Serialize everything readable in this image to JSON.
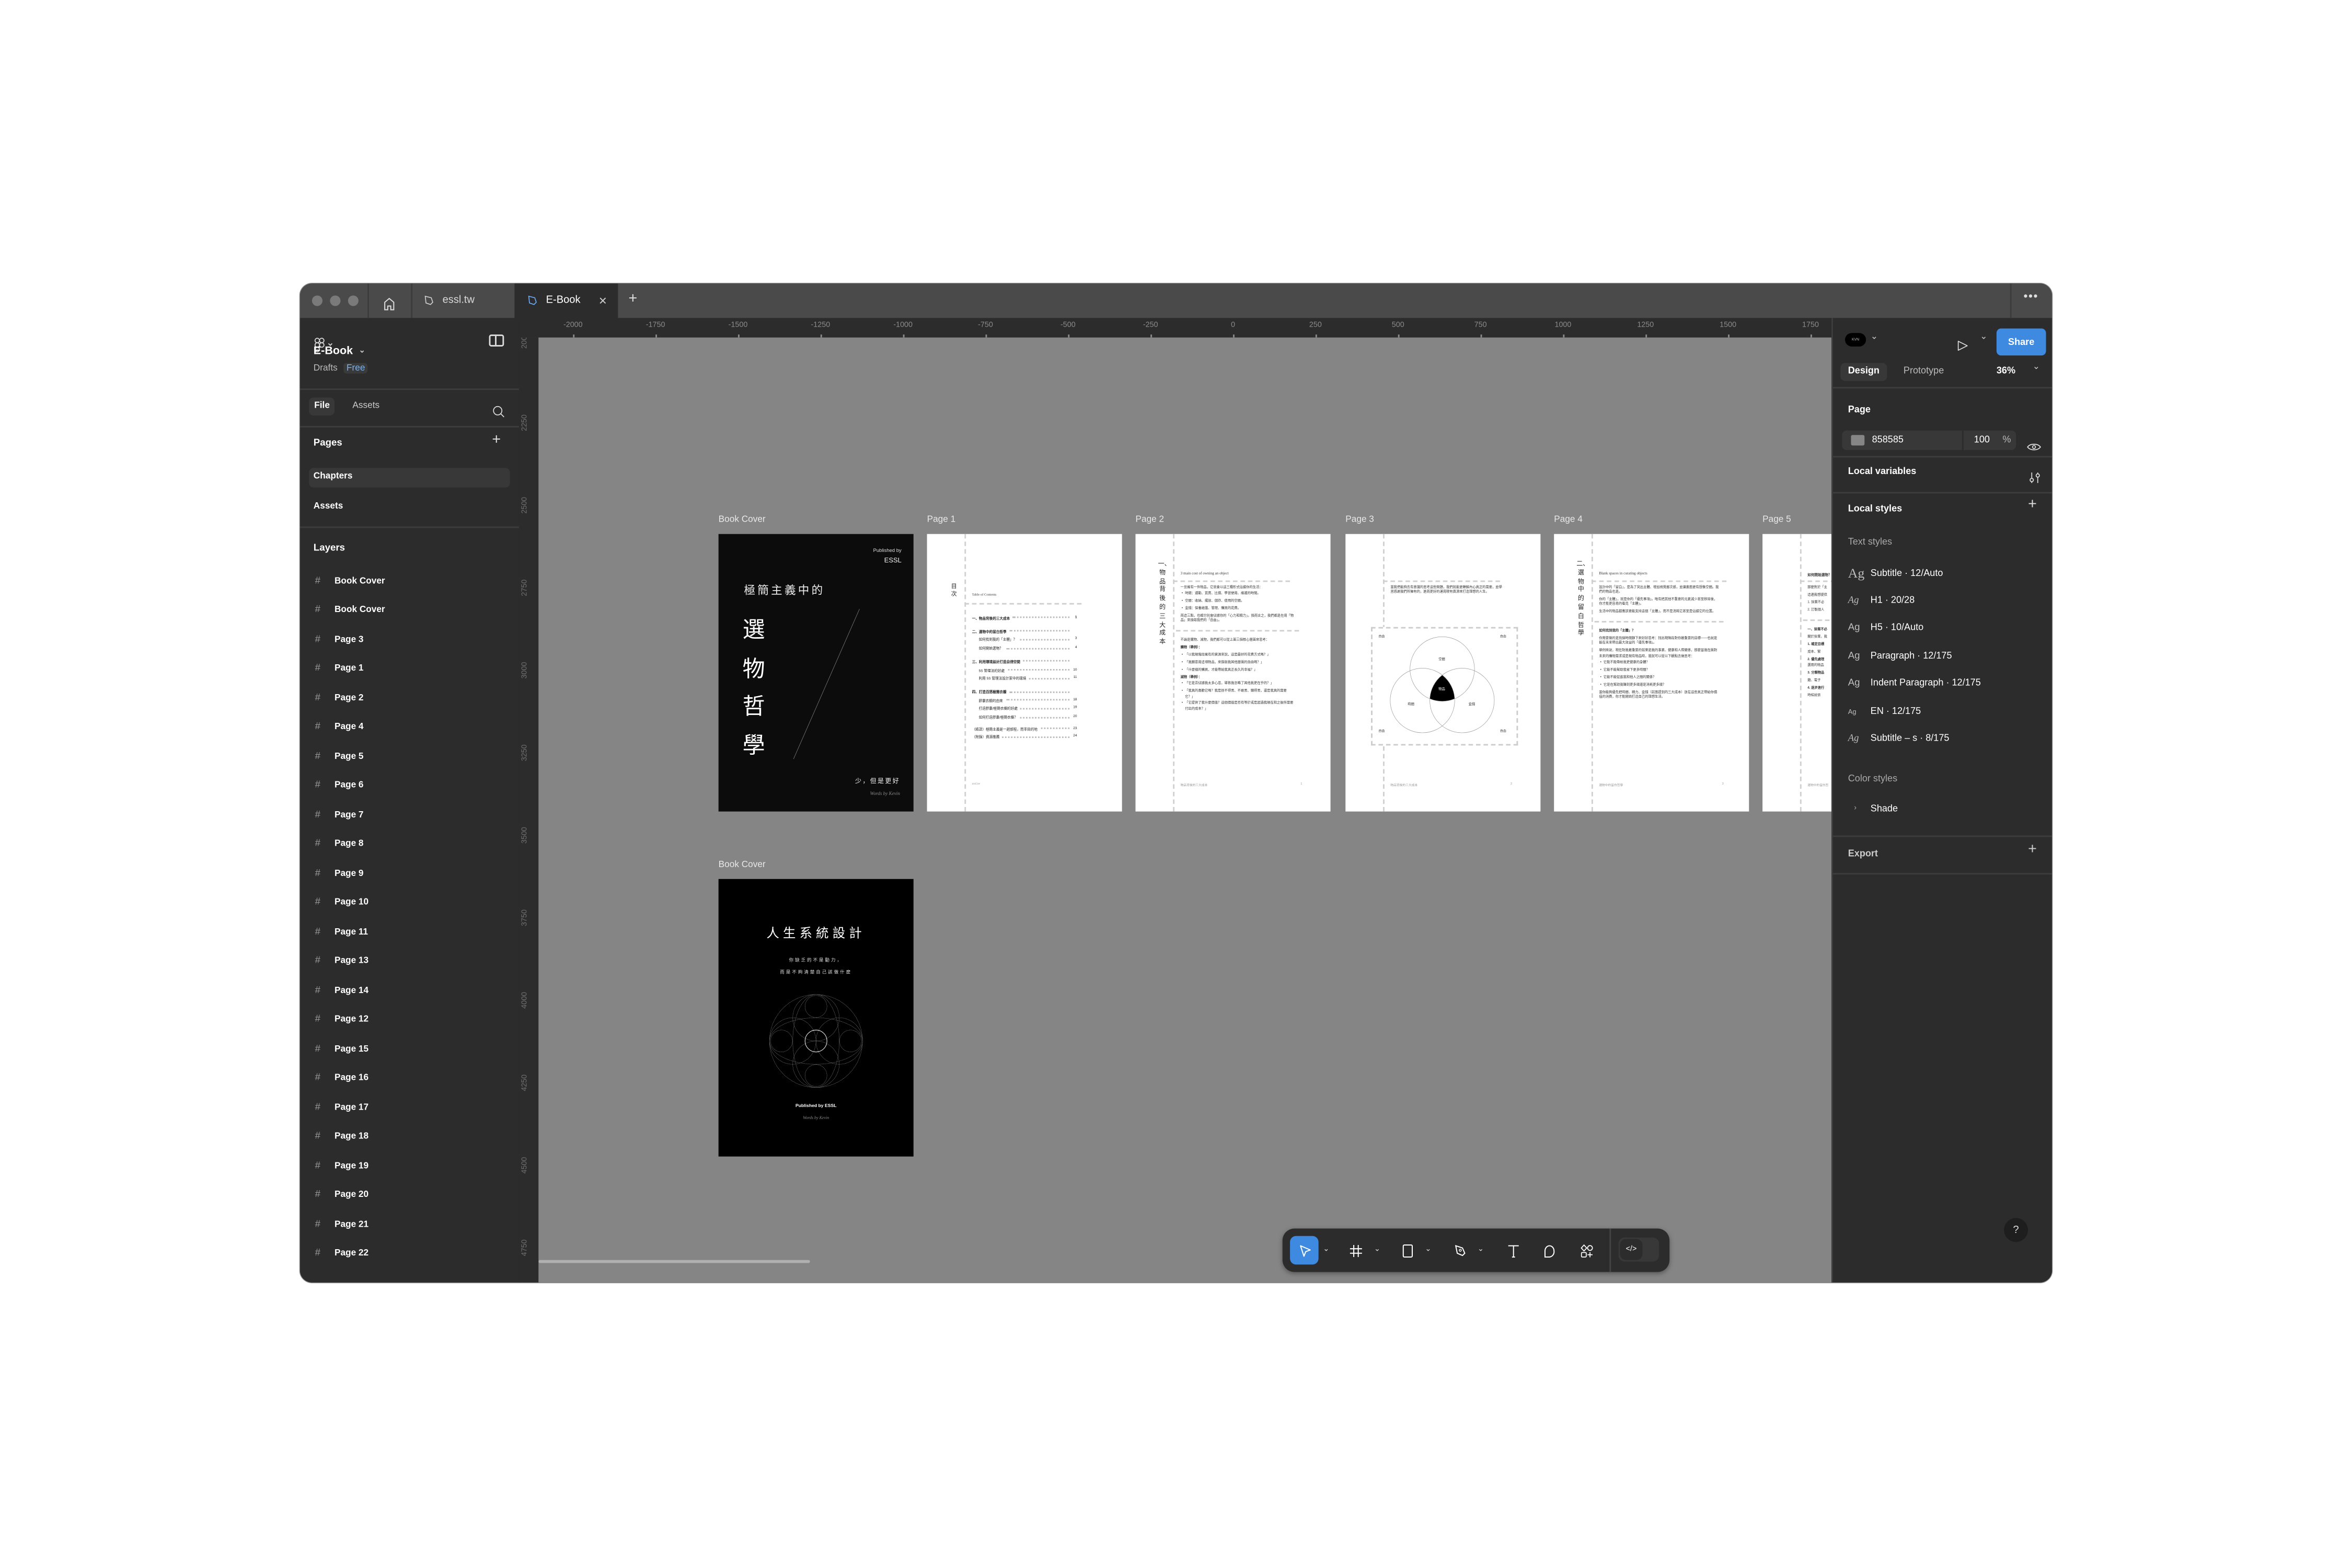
{
  "tabs": {
    "home_icon": "home-icon",
    "items": [
      {
        "label": "essl.tw",
        "active": false
      },
      {
        "label": "E-Book",
        "active": true
      }
    ],
    "new_tab_icon": "plus-icon",
    "more_icon": "ellipsis-icon"
  },
  "sidebar": {
    "file_name": "E-Book",
    "location": "Drafts",
    "plan_badge": "Free",
    "tab_file": "File",
    "tab_assets": "Assets",
    "pages_heading": "Pages",
    "pages": [
      {
        "label": "Chapters",
        "selected": true
      },
      {
        "label": "Assets",
        "selected": false
      }
    ],
    "layers_heading": "Layers",
    "layers": [
      {
        "label": "Book Cover"
      },
      {
        "label": "Book Cover"
      },
      {
        "label": "Page 3"
      },
      {
        "label": "Page 1"
      },
      {
        "label": "Page 2"
      },
      {
        "label": "Page 4"
      },
      {
        "label": "Page 5"
      },
      {
        "label": "Page 6"
      },
      {
        "label": "Page 7"
      },
      {
        "label": "Page 8"
      },
      {
        "label": "Page 9"
      },
      {
        "label": "Page 10"
      },
      {
        "label": "Page 11"
      },
      {
        "label": "Page 13"
      },
      {
        "label": "Page 14"
      },
      {
        "label": "Page 12"
      },
      {
        "label": "Page 15"
      },
      {
        "label": "Page 16"
      },
      {
        "label": "Page 17"
      },
      {
        "label": "Page 18"
      },
      {
        "label": "Page 19"
      },
      {
        "label": "Page 20"
      },
      {
        "label": "Page 21"
      },
      {
        "label": "Page 22"
      }
    ]
  },
  "rulers": {
    "x_labels": [
      -2000,
      -1750,
      -1500,
      -1250,
      -1000,
      -750,
      -500,
      -250,
      0,
      250,
      500,
      750,
      1000,
      1250,
      1500,
      1750
    ],
    "y_labels": [
      2000,
      2250,
      2500,
      2750,
      3000,
      3250,
      3500,
      3750,
      4000,
      4250,
      4500,
      4750
    ]
  },
  "canvas": {
    "background": "#858585",
    "frames": {
      "cover1": {
        "label": "Book Cover",
        "published_by": "Published by",
        "publisher": "ESSL",
        "pre_title": "極簡主義中的",
        "title_chars": [
          "選",
          "物",
          "哲",
          "學"
        ],
        "tagline": "少，但是更好",
        "author": "Words by Kevin"
      },
      "page1": {
        "label": "Page 1",
        "side_title": "目次",
        "subtitle": "Table of Contents",
        "toc": [
          {
            "type": "h",
            "text": "一、物品背後的三大成本",
            "page": "1"
          },
          {
            "type": "h",
            "text": "二、選物中的留白哲學",
            "page": ""
          },
          {
            "type": "s",
            "text": "如何找到我的「主體」？",
            "page": "3"
          },
          {
            "type": "s",
            "text": "如何開始選物？",
            "page": "4"
          },
          {
            "type": "h",
            "text": "三、利用環境設計打造自律空間",
            "page": ""
          },
          {
            "type": "s",
            "text": "5S 管理法的好處",
            "page": "10"
          },
          {
            "type": "s",
            "text": "利用 5S 管理法設計家中的環境",
            "page": "11"
          },
          {
            "type": "h",
            "text": "四、打造百搭極簡衣櫥",
            "page": ""
          },
          {
            "type": "s",
            "text": "膠囊衣櫥的由來",
            "page": "18"
          },
          {
            "type": "s",
            "text": "打造膠囊/極簡衣櫥的好處",
            "page": "19"
          },
          {
            "type": "s",
            "text": "如何打造膠囊/極簡衣櫥？",
            "page": "20"
          },
          {
            "type": "e",
            "text": "（結語）極簡主義是一趟旅程，而非目的地",
            "page": "23"
          },
          {
            "type": "f",
            "text": "（附錄）資源推薦",
            "page": "24"
          }
        ],
        "footer": "essl.tw"
      },
      "page2": {
        "label": "Page 2",
        "side_title": "一、物品背後的三大成本",
        "subtitle": "3 main cost of owning an object",
        "blocks": [
          {
            "type": "p",
            "text": "一旦擁有一件物品，它就會以這三種形式佔據你的生活："
          },
          {
            "type": "bullet",
            "text": "時間：通勤、買賣、比價、學習使用、維護的時間。"
          },
          {
            "type": "bullet",
            "text": "空間：收納、擺放、儲存、使用的空間。"
          },
          {
            "type": "bullet",
            "text": "金錢：保養維護、管理、購買的花費。"
          },
          {
            "type": "p",
            "text": "而這三點，也都分別會佔據你的「心力和精力」。換而言之，我們都是在用「物品」來換取我們的「自由」。"
          },
          {
            "type": "divider-line",
            "text": ""
          },
          {
            "type": "p",
            "text": "不論是購物、減物，我們都可以從上面三個核心層面來思考："
          },
          {
            "type": "h",
            "text": "購物（舉例）："
          },
          {
            "type": "bullet",
            "text": "「以我現階段擁有的資源來說，這是最好的花費方式嗎？」"
          },
          {
            "type": "bullet",
            "text": "「我願意用這項物品，來換取我其他層面的自由嗎？」"
          },
          {
            "type": "bullet",
            "text": "「什麼樣的購買，才能帶給我真正長久的幸福？」"
          },
          {
            "type": "h",
            "text": "減物（舉例）："
          },
          {
            "type": "bullet",
            "text": "「它是否佔據我太多心思，導致我忽略了其他我更在乎的？」"
          },
          {
            "type": "bullet",
            "text": "「我真的喜歡它嗎？我是捨不得丟、不敢丟、懶得丟，還是我真的需要它？」"
          },
          {
            "type": "bullet",
            "text": "「它提供了我什麼價值？這個價值是否有等於或是超過我現在和之後所需要付出的成本？」"
          }
        ],
        "footer": "物品背後的三大成本",
        "page_number": "1"
      },
      "page3": {
        "label": "Page 3",
        "paragraph": "當我們能夠去有意識的思考這些問題，我們就能更瞭解內心真正的需要，並學習感謝我們所擁有的，進而更好的運用現有資源來打造理想的人生。",
        "venn": {
          "top": "空間",
          "left": "時間",
          "right": "金錢",
          "center": "物品",
          "corners": [
            "自由",
            "自由",
            "自由",
            "自由"
          ]
        },
        "footer": "物品背後的三大成本",
        "page_number": "2"
      },
      "page4": {
        "label": "Page 4",
        "side_title": "二、選物中的留白哲學",
        "subtitle": "Blank spaces in curating objects",
        "blocks": [
          {
            "type": "p",
            "text": "設計中的「留白」，是為了突出主體、增加視覺層次感，並讓畫面更有想像空間。我們的物品也是。"
          },
          {
            "type": "p",
            "text": "你的「主體」，就是你的「優先事項」。唯有把其他不重要的元素減少甚至移除後，你才能更容易的看見「主體」。"
          },
          {
            "type": "p",
            "text": "生活中的物品都應該要能支持這個「主體」，而不是消耗它甚至是佔據它的位置。"
          },
          {
            "type": "divider-line",
            "text": ""
          },
          {
            "type": "h",
            "text": "如何找到我的「主體」？"
          },
          {
            "type": "p",
            "text": "你需要做的是找個時間靜下來好好思考：找出現階段對你最重要的目標——也就是能在未來帶出最大效益的「優先事項」。"
          },
          {
            "type": "p",
            "text": "舉例來說，現在對我最重要的如果是我的事業、健康和人際關係，那麼當我在面對未來的購物需求或是現有物品時，我就可以從以下觀點去做思考："
          },
          {
            "type": "bullet",
            "text": "它能不能帶給我更健康的身體？"
          },
          {
            "type": "bullet",
            "text": "它能不能幫助我省下更多時間？"
          },
          {
            "type": "bullet",
            "text": "它能不能促進我和他人之間的關係？"
          },
          {
            "type": "bullet",
            "text": "它是在幫助我賺到更多錢還是消耗更多錢？"
          },
          {
            "type": "p",
            "text": "當你能夠優先把時間、精力、金錢（前面提到的三大成本）放在這些真正帶給你價值的消費，你才能開始打造自己的理想生活。"
          }
        ],
        "footer": "選物中的留白哲學",
        "page_number": "3"
      },
      "page5": {
        "label": "Page 5",
        "subtitle": "如何開始選物？",
        "blocks": [
          {
            "type": "p",
            "text": "那麼對於「主"
          },
          {
            "type": "p",
            "text": "這邊我想提供"
          },
          {
            "type": "p",
            "text": "1. 捨棄不必"
          },
          {
            "type": "p",
            "text": "2. 訂製個人"
          },
          {
            "type": "divider-line",
            "text": ""
          },
          {
            "type": "h",
            "text": "一、捨棄不必"
          },
          {
            "type": "p",
            "text": "關於捨棄，我"
          },
          {
            "type": "h",
            "text": "1. 確定目標"
          },
          {
            "type": "p",
            "text": "成本、緊"
          },
          {
            "type": "h",
            "text": "2. 優先處理"
          },
          {
            "type": "p",
            "text": "選用的物品"
          },
          {
            "type": "h",
            "text": "3. 分類物品"
          },
          {
            "type": "p",
            "text": "籍、電子"
          },
          {
            "type": "h",
            "text": "4. 逐步進行"
          },
          {
            "type": "p",
            "text": "時候就依"
          }
        ],
        "footer": "選物中的留白哲"
      },
      "cover2": {
        "label": "Book Cover",
        "title": "人生系統設計",
        "subtitle_lines": [
          "你缺乏的不是動力，",
          "而是不夠清楚自己該做什麼"
        ],
        "published_by": "Published by ESSL",
        "author": "Words by Kevin"
      }
    }
  },
  "toolbar": {
    "tools": [
      "move-tool",
      "frame-tool",
      "rectangle-tool",
      "pen-tool",
      "text-tool",
      "comment-tool",
      "actions-tool",
      "dev-mode-toggle"
    ],
    "active_tool": "move-tool"
  },
  "right_panel": {
    "avatar_initials": "KVN",
    "share_label": "Share",
    "tab_design": "Design",
    "tab_prototype": "Prototype",
    "zoom": "36%",
    "page_heading": "Page",
    "page_color_hex": "858585",
    "page_color_swatch": "#858585",
    "page_opacity": "100",
    "percent_sign": "%",
    "local_variables": "Local variables",
    "local_styles": "Local styles",
    "text_styles_heading": "Text styles",
    "text_styles": [
      {
        "preview": "Ag",
        "name": "Subtitle · 12/Auto"
      },
      {
        "preview": "Ag",
        "name": "H1 · 20/28"
      },
      {
        "preview": "Ag",
        "name": "H5 · 10/Auto"
      },
      {
        "preview": "Ag",
        "name": "Paragraph · 12/175"
      },
      {
        "preview": "Ag",
        "name": "Indent Paragraph · 12/175"
      },
      {
        "preview": "Ag",
        "name": "EN · 12/175"
      },
      {
        "preview": "Ag",
        "name": "Subtitle – s · 8/175"
      }
    ],
    "color_styles_heading": "Color styles",
    "color_group": "Shade",
    "export_heading": "Export",
    "help_label": "?"
  },
  "colors": {
    "accent": "#3d8ae0",
    "panel": "#2c2c2c",
    "canvas": "#858585"
  }
}
